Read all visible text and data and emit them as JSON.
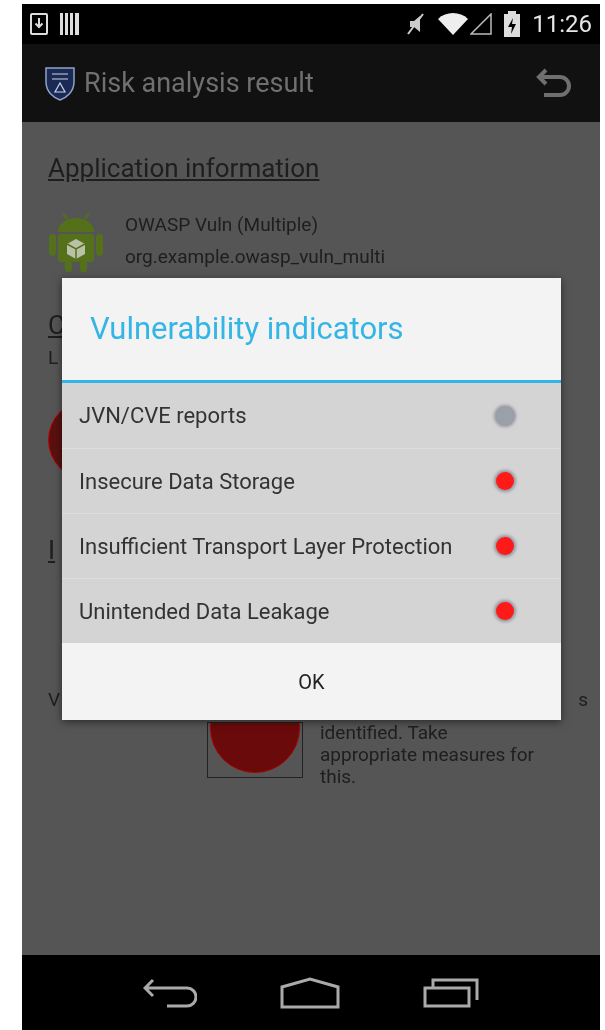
{
  "status_bar": {
    "time": "11:26"
  },
  "action_bar": {
    "title": "Risk analysis result"
  },
  "background": {
    "section_heading": "Application information",
    "app_name": "OWASP Vuln (Multiple)",
    "package": "org.example.owasp_vuln_multi",
    "heading_2_fragment": "C",
    "line_fragment": "L",
    "heading_3_fragment": "I",
    "row_left_fragment": "V",
    "row_right_fragment": "s",
    "message_lines": [
      "identified. Take",
      "appropriate measures for",
      "this."
    ]
  },
  "dialog": {
    "title": "Vulnerability indicators",
    "items": [
      {
        "label": "JVN/CVE reports",
        "color": "#9aa0aa"
      },
      {
        "label": "Insecure Data Storage",
        "color": "#ff1a1a"
      },
      {
        "label": "Insufficient Transport Layer Protection",
        "color": "#ff1a1a"
      },
      {
        "label": "Unintended Data Leakage",
        "color": "#ff1a1a"
      }
    ],
    "button": "OK"
  }
}
